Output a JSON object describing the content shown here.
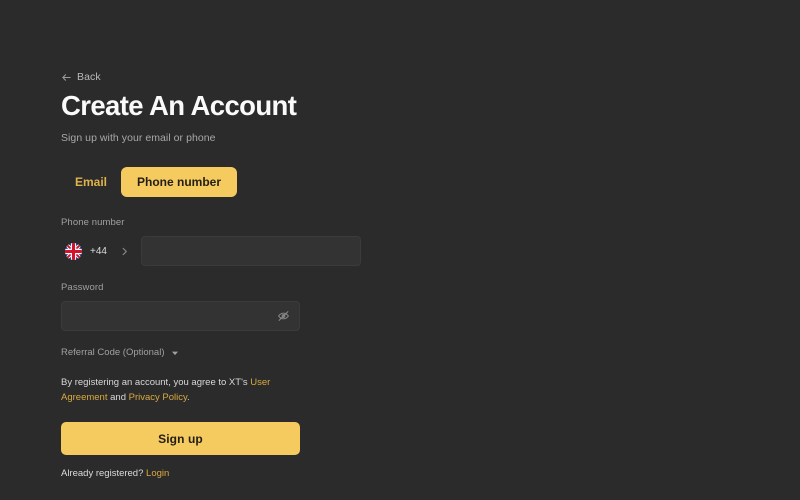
{
  "theme": {
    "background": "#2b2b2b",
    "accent": "#f5cb60",
    "link": "#d9a93f",
    "input_background": "#333333",
    "text_primary": "#fafafa",
    "text_muted": "#a0a0a0"
  },
  "nav": {
    "back_label": "Back",
    "back_icon": "arrow-left-icon"
  },
  "header": {
    "title": "Create An Account",
    "subtitle": "Sign up with your email or phone"
  },
  "tabs": [
    {
      "id": "email",
      "label": "Email",
      "active": false
    },
    {
      "id": "phone",
      "label": "Phone number",
      "active": true
    }
  ],
  "phone_field": {
    "label": "Phone number",
    "country": {
      "flag_icon": "flag-uk-icon",
      "dial_code": "+44",
      "chevron_icon": "chevron-right-icon"
    },
    "value": "",
    "placeholder": ""
  },
  "password_field": {
    "label": "Password",
    "value": "",
    "placeholder": "",
    "toggle_icon": "eye-off-icon"
  },
  "referral": {
    "label": "Referral Code (Optional)",
    "caret_icon": "caret-down-icon"
  },
  "terms": {
    "prefix": "By registering an account, you agree to XT's ",
    "link_user_agreement": "User Agreement",
    "middle": " and ",
    "link_privacy_policy": "Privacy Policy",
    "suffix": "."
  },
  "submit": {
    "label": "Sign up"
  },
  "footer": {
    "prompt": "Already registered? ",
    "login_label": "Login"
  }
}
